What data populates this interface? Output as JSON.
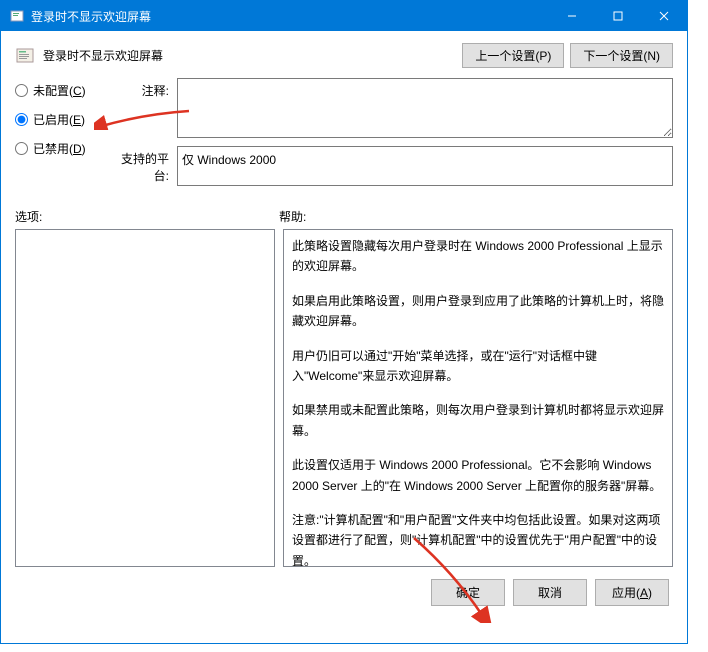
{
  "titlebar": {
    "title": "登录时不显示欢迎屏幕"
  },
  "header": {
    "policy_title": "登录时不显示欢迎屏幕",
    "prev_btn": "上一个设置(P)",
    "next_btn": "下一个设置(N)"
  },
  "radios": {
    "not_configured": "未配置(C)",
    "enabled": "已启用(E)",
    "disabled": "已禁用(D)"
  },
  "fields": {
    "comment_label": "注释:",
    "comment_value": "",
    "platform_label": "支持的平台:",
    "platform_value": "仅 Windows 2000"
  },
  "sections": {
    "options_label": "选项:",
    "help_label": "帮助:"
  },
  "help": {
    "p1": "此策略设置隐藏每次用户登录时在 Windows 2000 Professional 上显示的欢迎屏幕。",
    "p2": "如果启用此策略设置，则用户登录到应用了此策略的计算机上时，将隐藏欢迎屏幕。",
    "p3": "用户仍旧可以通过\"开始\"菜单选择，或在\"运行\"对话框中键入\"Welcome\"来显示欢迎屏幕。",
    "p4": "如果禁用或未配置此策略，则每次用户登录到计算机时都将显示欢迎屏幕。",
    "p5": "此设置仅适用于 Windows 2000 Professional。它不会影响 Windows 2000 Server 上的\"在 Windows 2000 Server 上配置你的服务器\"屏幕。",
    "p6": "注意:\"计算机配置\"和\"用户配置\"文件夹中均包括此设置。如果对这两项设置都进行了配置，则\"计算机配置\"中的设置优先于\"用户配置\"中的设置。"
  },
  "footer": {
    "ok": "确定",
    "cancel": "取消",
    "apply": "应用(A)"
  }
}
